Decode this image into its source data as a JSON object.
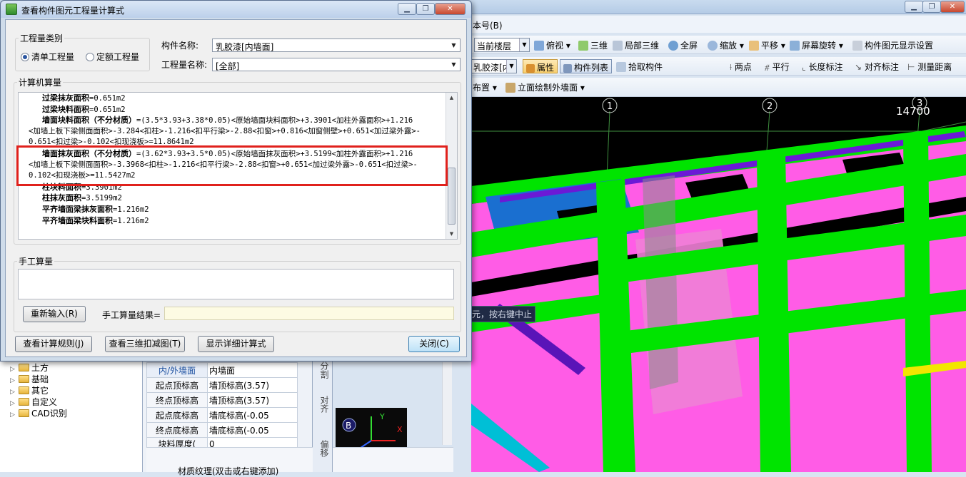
{
  "app": {
    "menu_fragment": "本号(B)",
    "toolbar1": {
      "floor_combo": "当前楼层",
      "view_top": "俯视",
      "view_3d": "三维",
      "local_3d": "局部三维",
      "fullscreen": "全屏",
      "zoom": "缩放",
      "pan": "平移",
      "rotate": "屏幕旋转",
      "display_settings": "构件图元显示设置"
    },
    "toolbar2": {
      "component_combo": "乳胶漆[内",
      "properties": "属性",
      "component_list": "构件列表",
      "pick_component": "拾取构件",
      "two_point": "两点",
      "parallel": "平行",
      "length_mark": "长度标注",
      "align_mark": "对齐标注",
      "measure_distance": "测量距离"
    },
    "toolbar3": {
      "layout": "布置",
      "elevation_outer_wall": "立面绘制外墙面"
    },
    "viewport": {
      "axis_labels": [
        "1",
        "2",
        "3"
      ],
      "dimension": "14700",
      "status_hint": "元，按右键中止",
      "coord_axes": [
        "B",
        "Y",
        "X"
      ]
    },
    "tree": [
      {
        "label": "土方"
      },
      {
        "label": "基础"
      },
      {
        "label": "其它"
      },
      {
        "label": "自定义"
      },
      {
        "label": "CAD识别"
      }
    ],
    "props": [
      {
        "key": "内/外墙面",
        "value": "内墙面"
      },
      {
        "key": "起点顶标高",
        "value": "墙顶标高(3.57)"
      },
      {
        "key": "终点顶标高",
        "value": "墙顶标高(3.57)"
      },
      {
        "key": "起点底标高",
        "value": "墙底标高(-0.05"
      },
      {
        "key": "终点底标高",
        "value": "墙底标高(-0.05"
      },
      {
        "key": "块料厚度(",
        "value": "0"
      }
    ],
    "props_bottom_text": "材质纹理(双击或右键添加)",
    "side_strip": [
      "分割",
      "对齐",
      "偏移"
    ]
  },
  "dialog": {
    "title": "查看构件图元工程量计算式",
    "quantity_type": {
      "legend": "工程量类别",
      "options": [
        "清单工程量",
        "定额工程量"
      ],
      "selected": "清单工程量"
    },
    "component_name_label": "构件名称:",
    "component_name_value": "乳胶漆[内墙面]",
    "quantity_name_label": "工程量名称:",
    "quantity_name_value": "[全部]",
    "computer_calc_legend": "计算机算量",
    "calc_lines": [
      {
        "indent": "key",
        "bold": "过梁抹灰面积",
        "rest": "=0.651m2"
      },
      {
        "indent": "key",
        "bold": "过梁块料面积",
        "rest": "=0.651m2"
      },
      {
        "indent": "key",
        "bold": "墙面块料面积（不分材质）",
        "rest": "=(3.5*3.93+3.38*0.05)<原始墙面块料面积>+3.3901<加柱外露面积>+1.216"
      },
      {
        "indent": "cont",
        "bold": "",
        "rest": "<加墙上板下梁侧面面积>-3.284<扣柱>-1.216<扣平行梁>-2.88<扣窗>+0.816<加窗侧壁>+0.651<加过梁外露>-"
      },
      {
        "indent": "cont",
        "bold": "",
        "rest": "0.651<扣过梁>-0.102<扣现浇板>=11.8641m2"
      },
      {
        "indent": "key",
        "bold": "墙面抹灰面积（不分材质）",
        "rest": "=(3.62*3.93+3.5*0.05)<原始墙面抹灰面积>+3.5199<加柱外露面积>+1.216"
      },
      {
        "indent": "cont",
        "bold": "",
        "rest": "<加墙上板下梁侧面面积>-3.3968<扣柱>-1.216<扣平行梁>-2.88<扣窗>+0.651<加过梁外露>-0.651<扣过梁>-"
      },
      {
        "indent": "cont",
        "bold": "",
        "rest": "0.102<扣现浇板>=11.5427m2"
      },
      {
        "indent": "key",
        "bold": "柱块料面积",
        "rest": "=3.3901m2"
      },
      {
        "indent": "key",
        "bold": "柱抹灰面积",
        "rest": "=3.5199m2"
      },
      {
        "indent": "key",
        "bold": "平齐墙面梁抹灰面积",
        "rest": "=1.216m2"
      },
      {
        "indent": "key",
        "bold": "平齐墙面梁块料面积",
        "rest": "=1.216m2"
      }
    ],
    "manual_calc_legend": "手工算量",
    "reenter_button": "重新输入(R)",
    "manual_result_label": "手工算量结果=",
    "manual_result_value": "",
    "view_rules_button": "查看计算规则(J)",
    "view_3d_deduct_button": "查看三维扣减图(T)",
    "show_detail_button": "显示详细计算式",
    "close_button": "关闭(C)"
  }
}
